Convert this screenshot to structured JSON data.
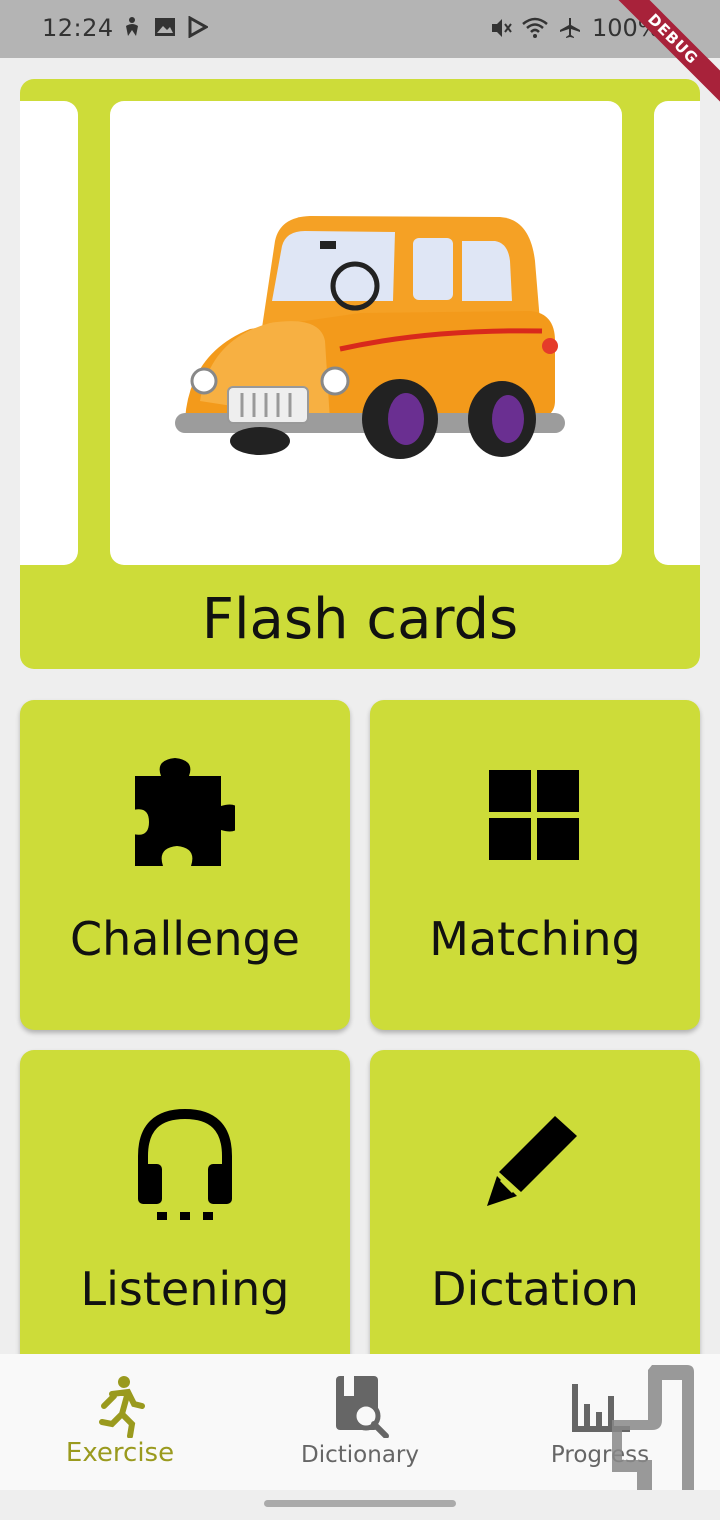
{
  "status_bar": {
    "time": "12:24",
    "battery": "100%",
    "debug_label": "DEBUG"
  },
  "flash_cards": {
    "title": "Flash cards",
    "image": "car-illustration"
  },
  "exercises": [
    {
      "label": "Challenge",
      "icon": "puzzle-icon"
    },
    {
      "label": "Matching",
      "icon": "grid-icon"
    },
    {
      "label": "Listening",
      "icon": "headphones-icon"
    },
    {
      "label": "Dictation",
      "icon": "pencil-icon"
    }
  ],
  "bottom_nav": {
    "items": [
      {
        "label": "Exercise",
        "icon": "running-icon",
        "active": true
      },
      {
        "label": "Dictionary",
        "icon": "dictionary-search-icon",
        "active": false
      },
      {
        "label": "Progress",
        "icon": "bar-chart-icon",
        "active": false
      }
    ]
  },
  "colors": {
    "accent": "#cddc39",
    "active_nav": "#9a9a1e",
    "background": "#eeeeee"
  }
}
